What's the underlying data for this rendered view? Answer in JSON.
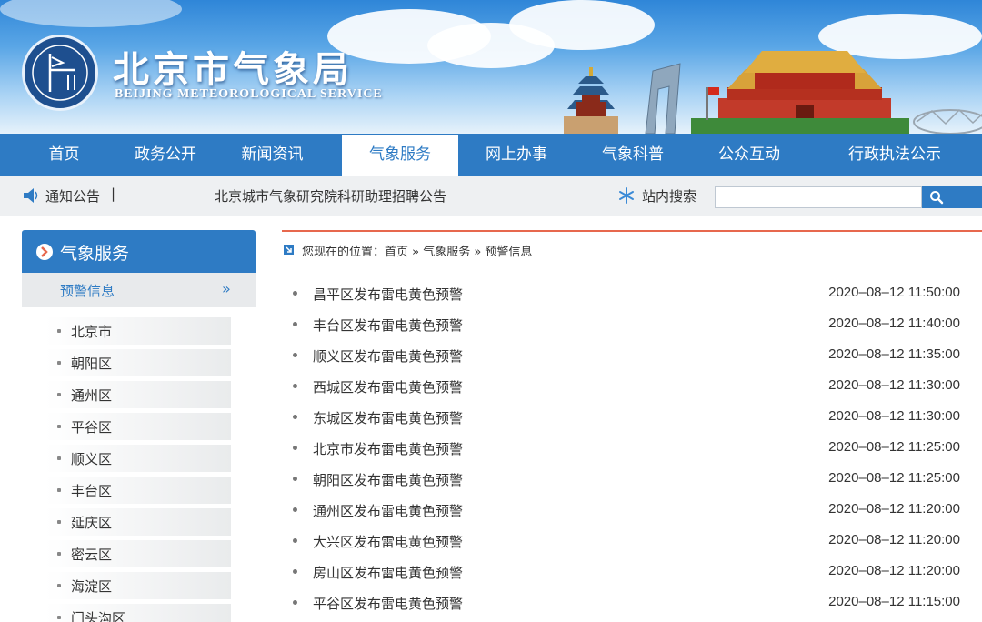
{
  "header": {
    "title": "北京市气象局",
    "subtitle": "BEIJING METEOROLOGICAL SERVICE"
  },
  "nav": {
    "items": [
      {
        "label": "首页"
      },
      {
        "label": "政务公开"
      },
      {
        "label": "新闻资讯"
      },
      {
        "label": "气象服务"
      },
      {
        "label": "网上办事"
      },
      {
        "label": "气象科普"
      },
      {
        "label": "公众互动"
      },
      {
        "label": "行政执法公示"
      }
    ],
    "active_index": 3
  },
  "notice": {
    "label": "通知公告",
    "separator": "|",
    "text": "北京城市气象研究院科研助理招聘公告"
  },
  "search": {
    "label": "站内搜索",
    "icon": "snowflake-icon",
    "value": ""
  },
  "sidebar": {
    "title": "气象服务",
    "active_label": "预警信息",
    "active_arrow": "»",
    "items": [
      {
        "label": "北京市"
      },
      {
        "label": "朝阳区"
      },
      {
        "label": "通州区"
      },
      {
        "label": "平谷区"
      },
      {
        "label": "顺义区"
      },
      {
        "label": "丰台区"
      },
      {
        "label": "延庆区"
      },
      {
        "label": "密云区"
      },
      {
        "label": "海淀区"
      },
      {
        "label": "门头沟区"
      }
    ]
  },
  "breadcrumb": {
    "text": "您现在的位置：首页 » 气象服务 » 预警信息"
  },
  "list": [
    {
      "title": "昌平区发布雷电黄色预警",
      "date": "2020–08–12 11:50:00"
    },
    {
      "title": "丰台区发布雷电黄色预警",
      "date": "2020–08–12 11:40:00"
    },
    {
      "title": "顺义区发布雷电黄色预警",
      "date": "2020–08–12 11:35:00"
    },
    {
      "title": "西城区发布雷电黄色预警",
      "date": "2020–08–12 11:30:00"
    },
    {
      "title": "东城区发布雷电黄色预警",
      "date": "2020–08–12 11:30:00"
    },
    {
      "title": "北京市发布雷电黄色预警",
      "date": "2020–08–12 11:25:00"
    },
    {
      "title": "朝阳区发布雷电黄色预警",
      "date": "2020–08–12 11:25:00"
    },
    {
      "title": "通州区发布雷电黄色预警",
      "date": "2020–08–12 11:20:00"
    },
    {
      "title": "大兴区发布雷电黄色预警",
      "date": "2020–08–12 11:20:00"
    },
    {
      "title": "房山区发布雷电黄色预警",
      "date": "2020–08–12 11:20:00"
    },
    {
      "title": "平谷区发布雷电黄色预警",
      "date": "2020–08–12 11:15:00"
    }
  ],
  "colors": {
    "primary": "#2e7bc4",
    "accent_line": "#e7684d"
  }
}
